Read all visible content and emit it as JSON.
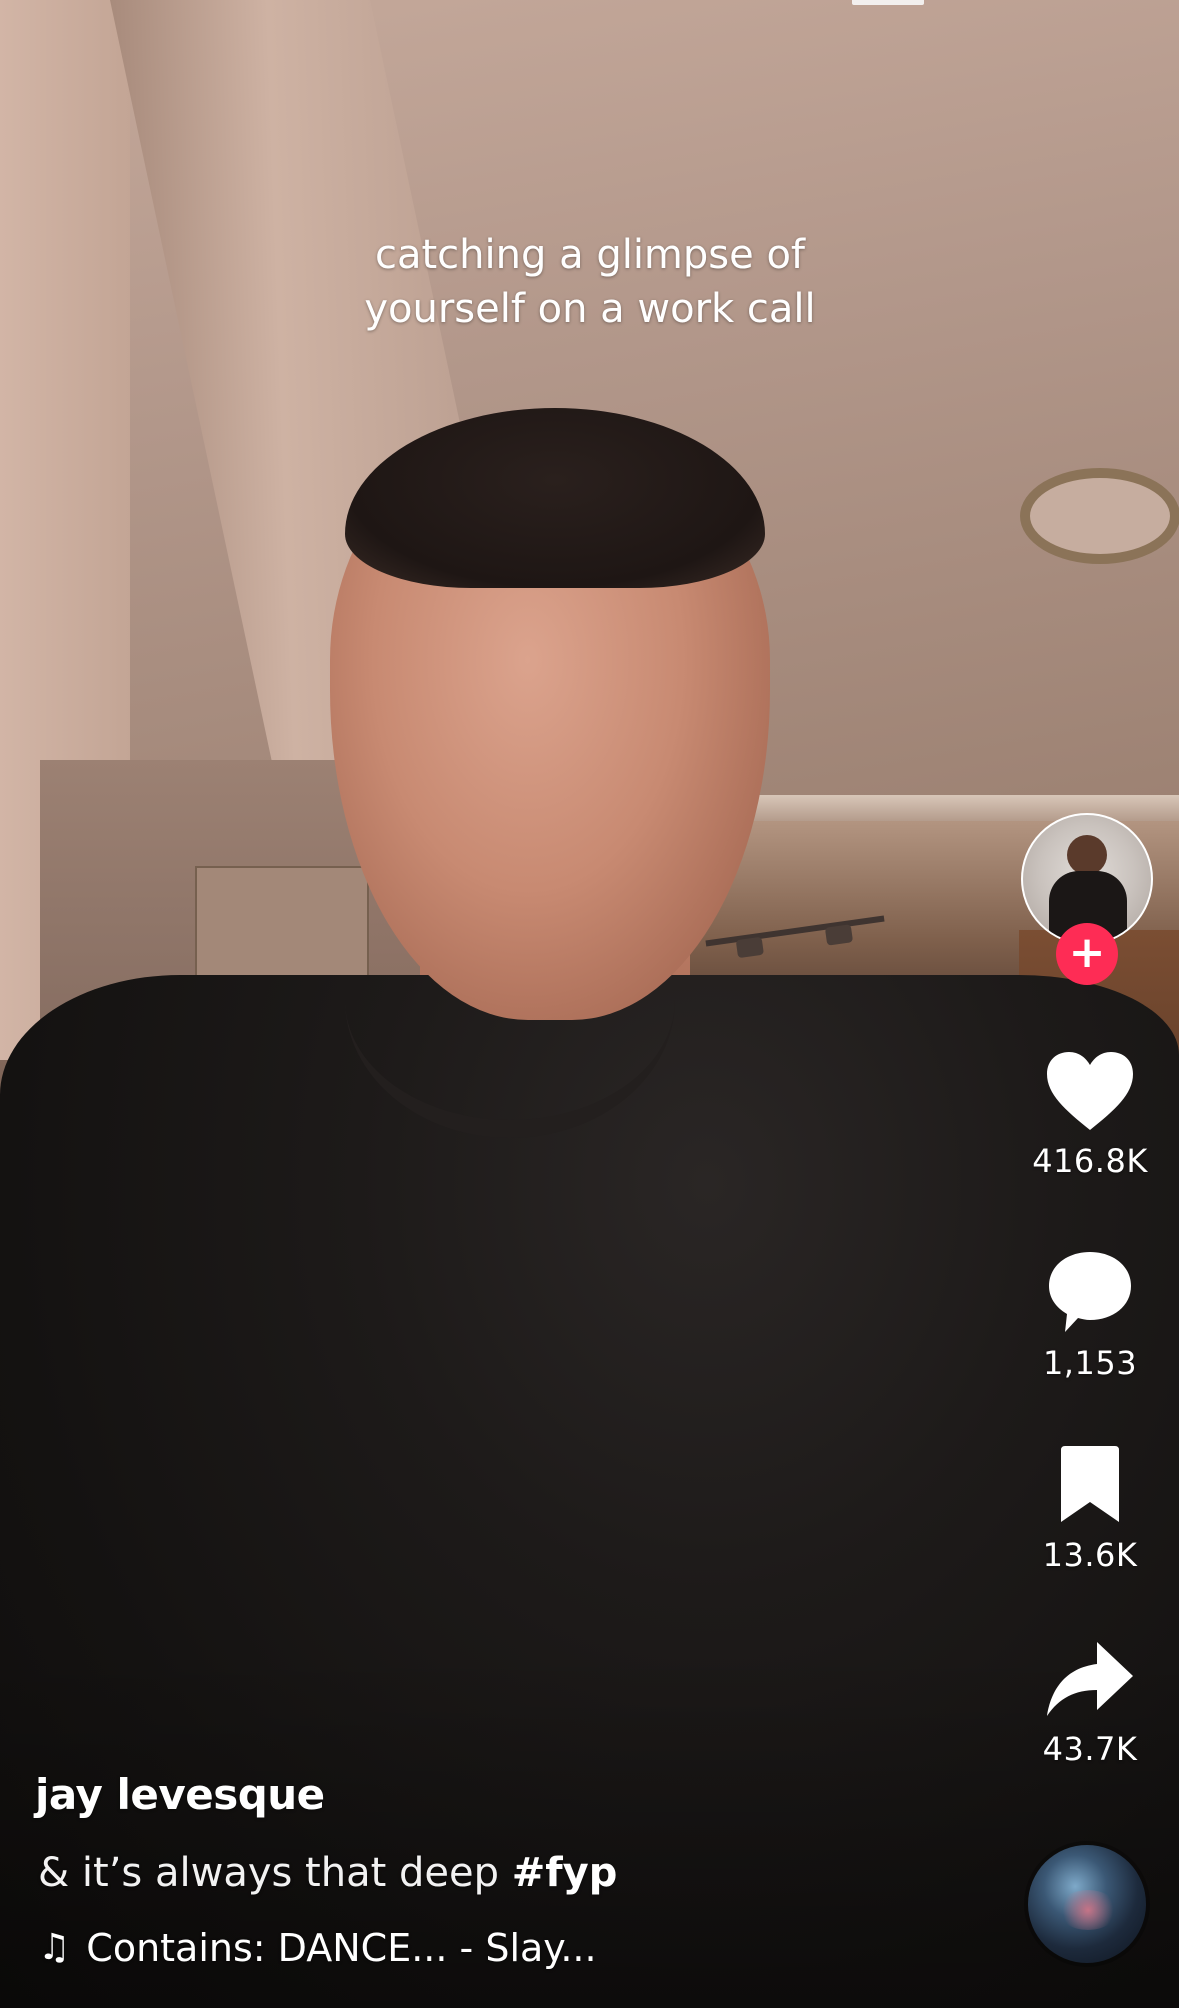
{
  "overlay": {
    "caption": "catching a glimpse of\nyourself on a work call"
  },
  "creator": {
    "name": "jay levesque",
    "follow_icon": "plus-icon"
  },
  "post": {
    "description": "& it’s always that deep",
    "hashtag": "#fyp",
    "music": "Contains: DANCE... - Slay..."
  },
  "actions": {
    "likes": "416.8K",
    "comments": "1,153",
    "saves": "13.6K",
    "shares": "43.7K"
  },
  "colors": {
    "follow_accent": "#fe2c55",
    "icon": "#ffffff"
  },
  "icons": [
    "heart-icon",
    "comment-icon",
    "bookmark-icon",
    "share-icon",
    "music-note-icon"
  ]
}
